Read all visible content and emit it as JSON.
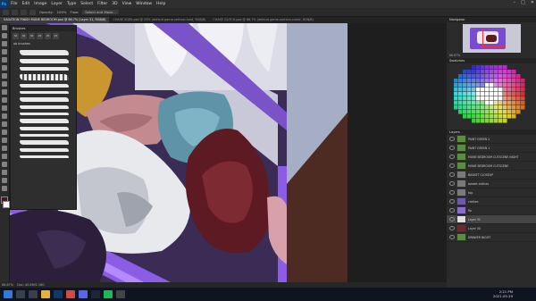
{
  "app": {
    "logo": "Ps",
    "menu": [
      "File",
      "Edit",
      "Image",
      "Layer",
      "Type",
      "Select",
      "Filter",
      "3D",
      "View",
      "Window",
      "Help"
    ]
  },
  "options_bar": {
    "opacity_label": "Opacity:",
    "opacity": "100%",
    "flow_label": "Flow:",
    "select_label": "Select and Mask..."
  },
  "tabs": [
    {
      "label": "SAGATION FINISH MUNE BEDROOM.psd @ 66.7% (Layer 31, RGB/8)",
      "active": true
    },
    {
      "label": "CHASE SGDk.psd @ 53% (default game-vertical-fund, RGB/8)",
      "active": false
    },
    {
      "label": "CHASE GLITCH.psd @ 66.7% (default game-vertical-comic, RGB/8)",
      "active": false
    }
  ],
  "brush_panel": {
    "title": "Brushes",
    "sizes": [
      "30",
      "30",
      "30",
      "25",
      "25",
      "25"
    ],
    "folder": "ab brushes"
  },
  "status": {
    "zoom": "66.67%",
    "doc": "Doc: 45.8M/1.16G"
  },
  "navigator": {
    "title": "Navigator",
    "zoom": "66.67%"
  },
  "swatches": {
    "title": "Swatches"
  },
  "layers": {
    "title": "Layers",
    "items": [
      {
        "name": "PAINT GREEN 2",
        "kind": "group"
      },
      {
        "name": "PAINT GREEN 1",
        "kind": "group"
      },
      {
        "name": "MUNE BEDROOM CUTSCENE NIGHT",
        "kind": "group"
      },
      {
        "name": "MUNE BEDROOM CUTSCENE",
        "kind": "group"
      },
      {
        "name": "BASKET CLOSEUP",
        "kind": "folder"
      },
      {
        "name": "basket clothes",
        "kind": "folder"
      },
      {
        "name": "top",
        "kind": "folder"
      },
      {
        "name": "clothes",
        "kind": "layer"
      },
      {
        "name": "flo",
        "kind": "layer"
      },
      {
        "name": "Layer 31",
        "kind": "layer",
        "selected": true
      },
      {
        "name": "Layer 30",
        "kind": "layer"
      },
      {
        "name": "DRAWER NIGHT",
        "kind": "group"
      }
    ]
  },
  "taskbar": {
    "time": "2:21 PM",
    "date": "2021-05-29"
  },
  "colors": {
    "ui_dark": "#2b2b2b",
    "basket_purple": "#8a56e8",
    "wall_blue": "#a8b0c8",
    "wine_red": "#5e1a22"
  }
}
